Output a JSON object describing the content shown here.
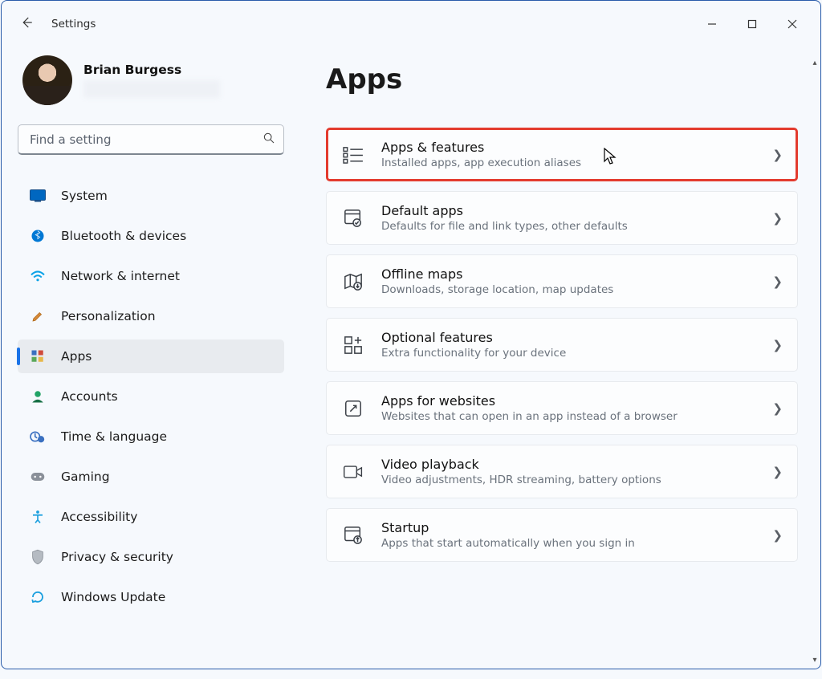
{
  "app_title": "Settings",
  "user": {
    "name": "Brian Burgess"
  },
  "search": {
    "placeholder": "Find a setting"
  },
  "sidebar": {
    "items": [
      {
        "label": "System",
        "icon": "monitor",
        "color": "#0067c0"
      },
      {
        "label": "Bluetooth & devices",
        "icon": "bluetooth",
        "color": "#0078d4"
      },
      {
        "label": "Network & internet",
        "icon": "wifi",
        "color": "#0aa2e7"
      },
      {
        "label": "Personalization",
        "icon": "brush",
        "color": "#c06a2a"
      },
      {
        "label": "Apps",
        "icon": "apps",
        "color": "#3a70c0",
        "active": true
      },
      {
        "label": "Accounts",
        "icon": "person",
        "color": "#21a366"
      },
      {
        "label": "Time & language",
        "icon": "clock-globe",
        "color": "#3a70c0"
      },
      {
        "label": "Gaming",
        "icon": "gamepad",
        "color": "#8a9099"
      },
      {
        "label": "Accessibility",
        "icon": "accessibility",
        "color": "#1a9fde"
      },
      {
        "label": "Privacy & security",
        "icon": "shield",
        "color": "#8a9099"
      },
      {
        "label": "Windows Update",
        "icon": "update",
        "color": "#1a9fde"
      }
    ]
  },
  "page": {
    "title": "Apps"
  },
  "cards": [
    {
      "title": "Apps & features",
      "sub": "Installed apps, app execution aliases",
      "icon": "apps-list",
      "highlight": true
    },
    {
      "title": "Default apps",
      "sub": "Defaults for file and link types, other defaults",
      "icon": "default-apps"
    },
    {
      "title": "Offline maps",
      "sub": "Downloads, storage location, map updates",
      "icon": "map"
    },
    {
      "title": "Optional features",
      "sub": "Extra functionality for your device",
      "icon": "add-squares"
    },
    {
      "title": "Apps for websites",
      "sub": "Websites that can open in an app instead of a browser",
      "icon": "open-in-app"
    },
    {
      "title": "Video playback",
      "sub": "Video adjustments, HDR streaming, battery options",
      "icon": "video"
    },
    {
      "title": "Startup",
      "sub": "Apps that start automatically when you sign in",
      "icon": "startup"
    }
  ]
}
